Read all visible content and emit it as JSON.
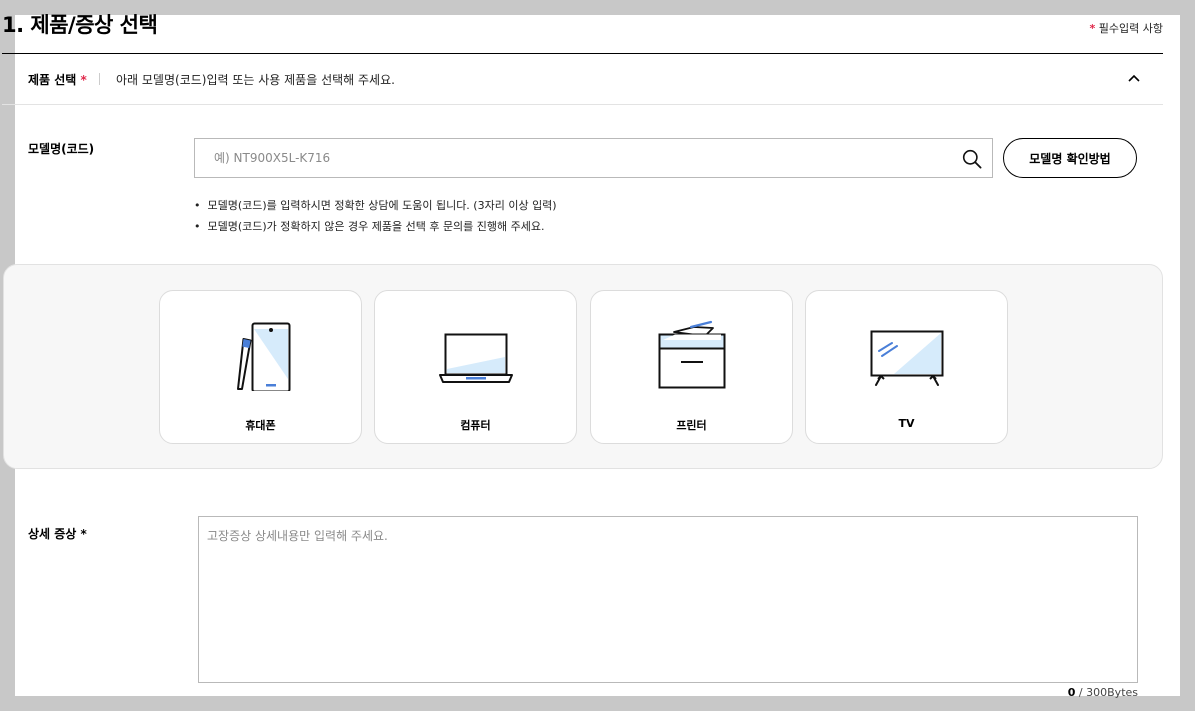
{
  "section": {
    "title": "1. 제품/증상 선택",
    "required_star": "*",
    "required_note": "필수입력 사항"
  },
  "product_select": {
    "label": "제품 선택",
    "star": "*",
    "description": "아래 모델명(코드)입력 또는 사용 제품을 선택해 주세요.",
    "chevron_icon": "chevron-up-icon"
  },
  "model": {
    "label": "모델명(코드)",
    "placeholder": "예) NT900X5L-K716",
    "value": "",
    "search_icon": "search-icon",
    "check_button": "모델명 확인방법",
    "notes": [
      "모델명(코드)를 입력하시면 정확한 상담에 도움이 됩니다. (3자리 이상 입력)",
      "모델명(코드)가 정확하지 않은 경우 제품을 선택 후 문의를 진행해 주세요."
    ]
  },
  "categories": [
    {
      "label": "휴대폰",
      "icon": "phone-icon"
    },
    {
      "label": "컴퓨터",
      "icon": "laptop-icon"
    },
    {
      "label": "프린터",
      "icon": "printer-icon"
    },
    {
      "label": "TV",
      "icon": "tv-icon"
    }
  ],
  "detail": {
    "label": "상세 증상",
    "star": "*",
    "placeholder": "고장증상 상세내용만 입력해 주세요.",
    "value": "",
    "count": "0",
    "limit": " / 300Bytes"
  },
  "colors": {
    "accent": "#e0284a",
    "icon_blue": "#4a7fd8",
    "icon_light_blue": "#d6ebfb",
    "panel_bg": "#f7f7f7"
  }
}
